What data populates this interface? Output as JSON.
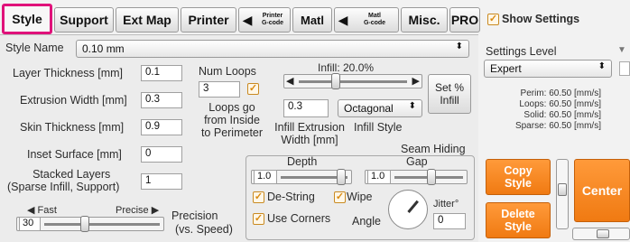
{
  "tabs": {
    "style": "Style",
    "support": "Support",
    "ext_map": "Ext Map",
    "printer": "Printer",
    "printer_gcode_1": "Printer",
    "printer_gcode_2": "G-code",
    "matl": "Matl",
    "matl_gcode_1": "Matl",
    "matl_gcode_2": "G-code",
    "misc": "Misc.",
    "pro": "PRO"
  },
  "style_name": {
    "label": "Style Name",
    "value": "0.10 mm"
  },
  "fields": {
    "layer_thickness": {
      "label": "Layer Thickness [mm]",
      "value": "0.1"
    },
    "extrusion_width": {
      "label": "Extrusion Width [mm]",
      "value": "0.3"
    },
    "skin_thickness": {
      "label": "Skin Thickness [mm]",
      "value": "0.9"
    },
    "inset_surface": {
      "label": "Inset  Surface [mm]",
      "value": "0"
    },
    "stacked_layers_1": "Stacked Layers",
    "stacked_layers_2": "(Sparse Infill, Support)",
    "stacked_layers_value": "1"
  },
  "num_loops": {
    "label": "Num Loops",
    "value": "3"
  },
  "loops_text": [
    "Loops go",
    "from Inside",
    "to Perimeter"
  ],
  "infill": {
    "title": "Infill: 20.0%",
    "percent": 20.0,
    "extrusion_width_value": "0.3",
    "extrusion_width_label_1": "Infill Extrusion",
    "extrusion_width_label_2": "Width [mm]",
    "style_value": "Octagonal",
    "style_label": "Infill Style",
    "set_btn_1": "Set %",
    "set_btn_2": "Infill"
  },
  "seam": {
    "title": "Seam Hiding",
    "depth_label": "Depth",
    "depth_value": "1.0",
    "gap_label": "Gap",
    "gap_value": "1.0",
    "destring": "De-String",
    "wipe": "Wipe",
    "use_corners": "Use Corners",
    "angle": "Angle",
    "jitter": "Jitter°",
    "jitter_value": "0"
  },
  "precision": {
    "fast": "Fast",
    "precise": "Precise",
    "value": "30",
    "label_1": "Precision",
    "label_2": "(vs. Speed)"
  },
  "right": {
    "show_settings": "Show Settings",
    "settings_level_label": "Settings Level",
    "settings_level_value": "Expert",
    "perim": "Perim: 60.50 [mm/s]",
    "loops": "Loops: 60.50 [mm/s]",
    "solid": "Solid: 60.50 [mm/s]",
    "sparse": "Sparse: 60.50 [mm/s]",
    "copy_style_1": "Copy",
    "copy_style_2": "Style",
    "delete_style_1": "Delete",
    "delete_style_2": "Style",
    "center": "Center"
  },
  "colors": {
    "accent": "#f07a12",
    "tab_highlight": "#e0127a"
  }
}
